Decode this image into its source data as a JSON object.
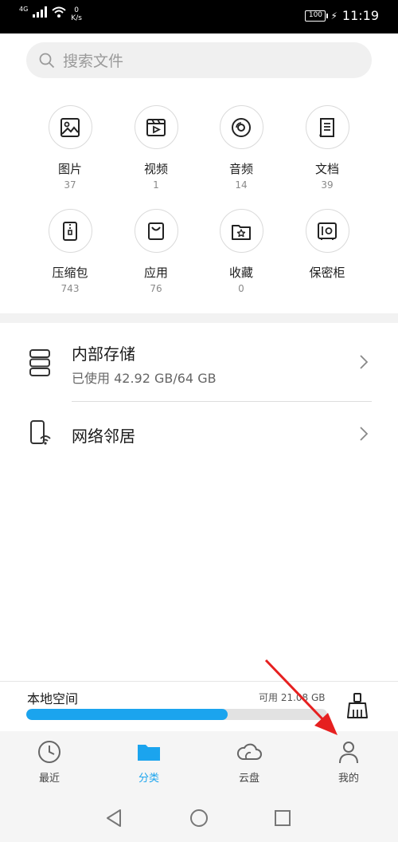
{
  "status_bar": {
    "network": "4G",
    "speed_value": "0",
    "speed_unit": "K/s",
    "battery": "100",
    "time": "11:19"
  },
  "search": {
    "placeholder": "搜索文件"
  },
  "categories": [
    {
      "label": "图片",
      "count": "37",
      "icon": "image-icon"
    },
    {
      "label": "视频",
      "count": "1",
      "icon": "video-icon"
    },
    {
      "label": "音频",
      "count": "14",
      "icon": "audio-icon"
    },
    {
      "label": "文档",
      "count": "39",
      "icon": "document-icon"
    },
    {
      "label": "压缩包",
      "count": "743",
      "icon": "archive-icon"
    },
    {
      "label": "应用",
      "count": "76",
      "icon": "app-bag-icon"
    },
    {
      "label": "收藏",
      "count": "0",
      "icon": "star-folder-icon"
    },
    {
      "label": "保密柜",
      "count": "",
      "icon": "safe-icon"
    }
  ],
  "storage_list": {
    "internal": {
      "title": "内部存储",
      "subtitle": "已使用 42.92 GB/64 GB"
    },
    "network": {
      "title": "网络邻居"
    }
  },
  "local_space": {
    "title": "本地空间",
    "available": "可用 21.08 GB",
    "used_fraction": 0.67
  },
  "bottom_nav": [
    {
      "label": "最近",
      "icon": "clock-icon",
      "active": false
    },
    {
      "label": "分类",
      "icon": "folder-icon",
      "active": true
    },
    {
      "label": "云盘",
      "icon": "cloud-icon",
      "active": false
    },
    {
      "label": "我的",
      "icon": "person-icon",
      "active": false
    }
  ],
  "colors": {
    "accent": "#1ba4ee",
    "annotation_arrow": "#e62020"
  }
}
